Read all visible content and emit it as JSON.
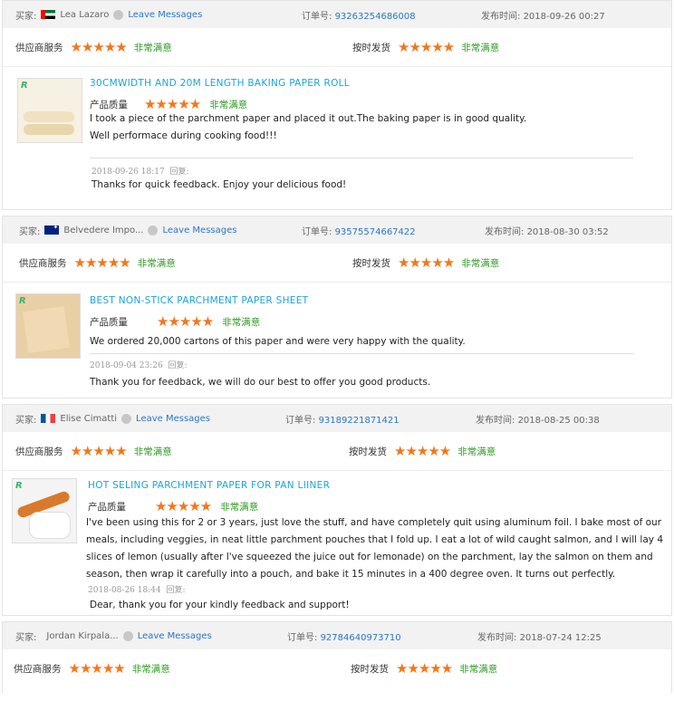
{
  "labels": {
    "buyer": "买家:",
    "order": "订单号:",
    "published": "发布时间:",
    "supplier_service": "供应商服务",
    "on_time": "按时发货",
    "product_quality": "产品质量",
    "very_satisfied": "非常满意",
    "leave_messages": "Leave Messages",
    "reply": "回复:",
    "stars": "★★★★★"
  },
  "reviews": [
    {
      "buyer": "Lea Lazaro",
      "flag": "flag-ae",
      "order_no": "93263254686008",
      "published": "2018-09-26 00:27",
      "product_title": "30CMWIDTH AND 20M LENGTH BAKING PAPER ROLL",
      "text": "I took a piece of the parchment paper and placed it out.The baking paper is in good quality.\nWell performace during cooking food!!!",
      "reply_meta": "2018-09-26 18:17",
      "reply": "Thanks for quick feedback. Enjoy your delicious food!"
    },
    {
      "buyer": "Belvedere Impo...",
      "flag": "flag-au",
      "order_no": "93575574667422",
      "published": "2018-08-30 03:52",
      "product_title": "BEST NON-STICK PARCHMENT PAPER SHEET",
      "text": "We ordered 20,000 cartons of this paper and were very happy with the quality.",
      "reply_meta": "2018-09-04 23:26",
      "reply": "Thank you for feedback, we will do our best to offer you good products."
    },
    {
      "buyer": "Elise Cimatti",
      "flag": "flag-fr",
      "order_no": "93189221871421",
      "published": "2018-08-25 00:38",
      "product_title": "HOT SELING PARCHMENT PAPER FOR PAN LIINER",
      "text": "I've been using this for 2 or 3 years, just love the stuff, and have completely quit using aluminum foil. I bake most of our meals, including veggies, in neat little parchment pouches that I fold up. I eat a lot of wild caught salmon, and I will lay 4 slices of lemon (usually after I've squeezed the juice out for lemonade) on the parchment, lay the salmon on them and season, then wrap it carefully into a pouch, and bake it 15 minutes in a 400 degree oven. It turns out perfectly.",
      "reply_meta": "2018-08-26 18:44",
      "reply": "Dear, thank you for your kindly feedback and support!"
    },
    {
      "buyer": "Jordan Kirpala...",
      "flag": "",
      "order_no": "92784640973710",
      "published": "2018-07-24 12:25"
    }
  ]
}
